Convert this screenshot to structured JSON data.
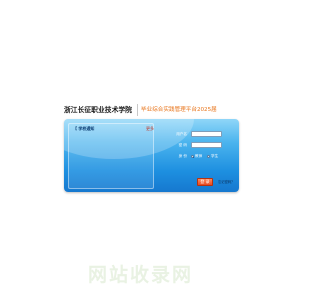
{
  "header": {
    "school_name": "浙江长征职业技术学院",
    "platform_name": "毕业综合实践管理平台2025届"
  },
  "notice": {
    "title": "【 学校通知",
    "more": "更多"
  },
  "login_form": {
    "username_label": "用户名",
    "username_value": "",
    "password_label": "密  码",
    "password_value": "",
    "identity_label": "身  份",
    "identity_options": [
      {
        "label": "教师",
        "selected": true
      },
      {
        "label": "学生",
        "selected": false
      }
    ],
    "login_button": "登 录",
    "forgot_link": "忘记密码？"
  },
  "watermark": {
    "text": "网站收录网"
  },
  "colors": {
    "panel_top": "#8fd6f8",
    "panel_bottom": "#1678cf",
    "platform_name": "#e8741a",
    "button": "#e8471e",
    "watermark": "#e9f2e3"
  }
}
